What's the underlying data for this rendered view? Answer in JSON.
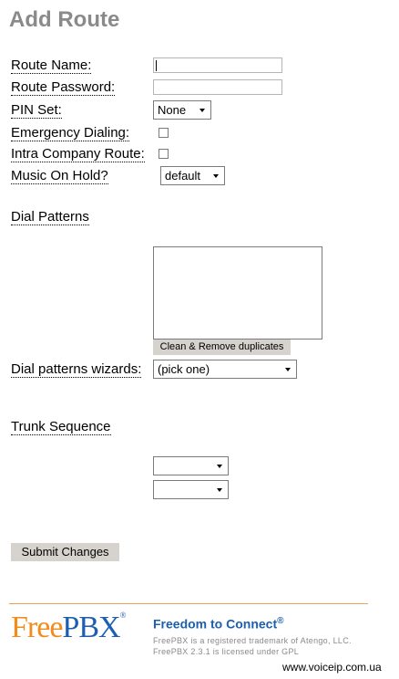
{
  "page": {
    "title": "Add Route"
  },
  "form": {
    "route_name_label": "Route Name:",
    "route_name_value": "",
    "route_password_label": "Route Password:",
    "route_password_value": "",
    "pin_set_label": "PIN Set:",
    "pin_set_value": "None",
    "emergency_label": "Emergency Dialing:",
    "emergency_checked": false,
    "intra_label": "Intra Company Route:",
    "intra_checked": false,
    "moh_label": "Music On Hold?",
    "moh_value": "default"
  },
  "dial_patterns": {
    "heading": "Dial Patterns",
    "value": "",
    "clean_button": "Clean & Remove duplicates",
    "wizard_label": "Dial patterns wizards:",
    "wizard_value": "(pick one)"
  },
  "trunk_sequence": {
    "heading": "Trunk Sequence",
    "trunks": [
      "",
      ""
    ]
  },
  "submit_label": "Submit Changes",
  "footer": {
    "logo_free": "Free",
    "logo_pbx": "PBX",
    "logo_reg": "®",
    "tagline": "Freedom to Connect",
    "tagline_reg": "®",
    "trademark_note": "FreePBX is a registered trademark of Atengo, LLC.",
    "license_note": "FreePBX 2.3.1 is licensed under GPL"
  },
  "watermark": "www.voiceip.com.ua",
  "colors": {
    "accent_orange": "#f28c1c",
    "accent_blue": "#1d5fae",
    "title_gray": "#8a8a8a"
  }
}
